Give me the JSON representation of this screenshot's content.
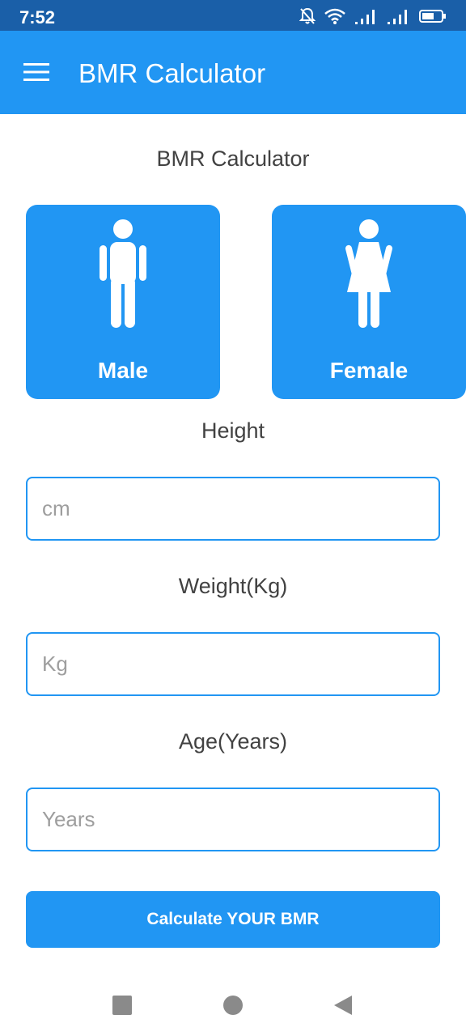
{
  "status_bar": {
    "time": "7:52",
    "icons": [
      "bell-off-icon",
      "wifi-icon",
      "signal-icon",
      "signal-icon",
      "battery-icon"
    ]
  },
  "app_bar": {
    "menu_icon": "hamburger-menu-icon",
    "title": "BMR Calculator"
  },
  "main": {
    "heading": "BMR Calculator",
    "gender": {
      "male_label": "Male",
      "female_label": "Female",
      "male_icon": "male-figure-icon",
      "female_icon": "female-figure-icon"
    },
    "height": {
      "label": "Height",
      "placeholder": "cm",
      "value": ""
    },
    "weight": {
      "label": "Weight(Kg)",
      "placeholder": "Kg",
      "value": ""
    },
    "age": {
      "label": "Age(Years)",
      "placeholder": "Years",
      "value": ""
    },
    "calculate_label": "Calculate YOUR BMR"
  },
  "nav_bar": {
    "icons": [
      "recents-square-icon",
      "home-circle-icon",
      "back-triangle-icon"
    ]
  },
  "colors": {
    "primary": "#2196f3",
    "status_bar": "#1a5fa8",
    "text": "#424242",
    "placeholder": "#9e9e9e"
  }
}
